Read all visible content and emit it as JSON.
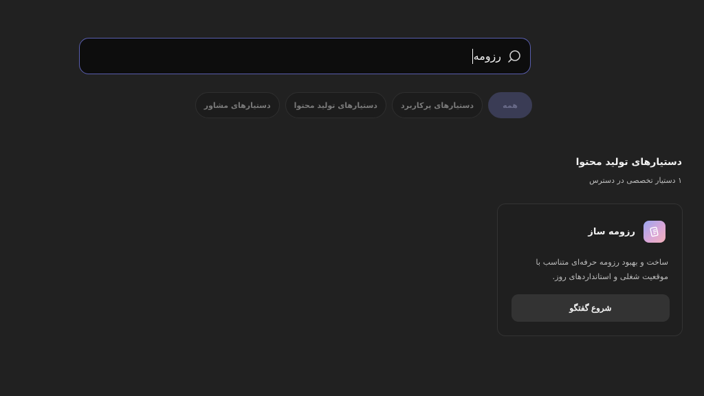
{
  "search": {
    "value": "رزومه",
    "icon": "search-icon"
  },
  "filters": [
    {
      "label": "همه",
      "active": true
    },
    {
      "label": "دستیارهای پرکاربرد",
      "active": false
    },
    {
      "label": "دستیارهای تولید محتوا",
      "active": false
    },
    {
      "label": "دستیارهای مشاور",
      "active": false
    }
  ],
  "section": {
    "title": "دستیارهای تولید محتوا",
    "subtitle": "۱ دستیار تخصصی در دسترس"
  },
  "card": {
    "title": "رزومه ساز",
    "icon": "resume-icon",
    "description": "ساخت و بهبود رزومه حرفه‌ای متناسب با موقعیت شغلی و استانداردهای روز.",
    "button_label": "شروع گفتگو"
  },
  "colors": {
    "background": "#212121",
    "search_border": "#5a5fb0",
    "active_chip": "#3a3c55"
  }
}
